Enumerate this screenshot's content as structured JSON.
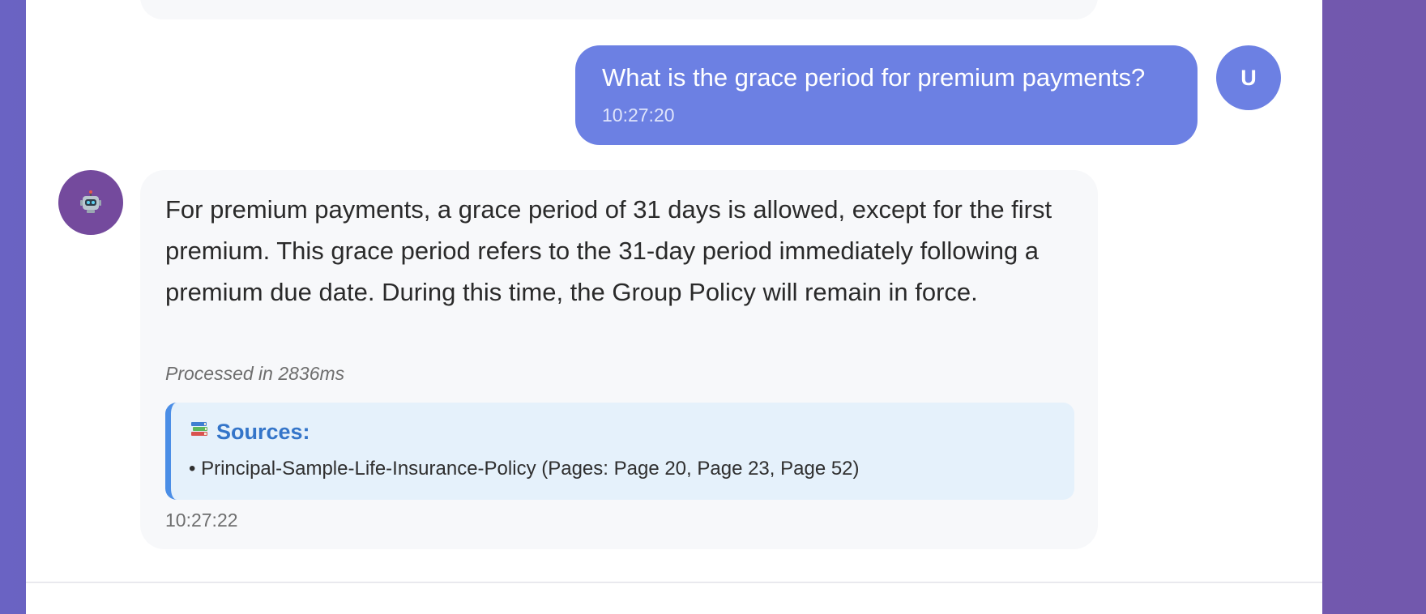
{
  "user_message": {
    "avatar_letter": "U",
    "text": "What is the grace period for premium payments?",
    "time": "10:27:20"
  },
  "bot_message": {
    "avatar_icon": "robot-icon",
    "text": "For premium payments, a grace period of 31 days is allowed, except for the first premium. This grace period refers to the 31-day period immediately following a premium due date. During this time, the Group Policy will remain in force.",
    "processed": "Processed in 2836ms",
    "sources_icon": "books-icon",
    "sources_title": "Sources:",
    "sources": [
      "• Principal-Sample-Life-Insurance-Policy (Pages: Page 20, Page 23, Page 52)"
    ],
    "time": "10:27:22"
  },
  "colors": {
    "user_bubble": "#6c80e3",
    "bot_avatar": "#744a9d",
    "sources_accent": "#4b8ee6",
    "sources_title": "#3475c9"
  }
}
